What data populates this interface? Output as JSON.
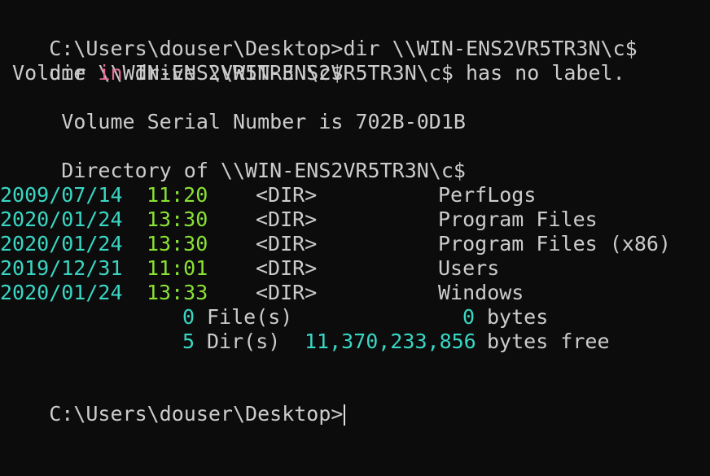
{
  "terminal": {
    "prompt_command": "C:\\Users\\douser\\Desktop>dir \\\\WIN-ENS2VR5TR3N\\c$",
    "echo": "dir \\\\WIN-ENS2VR5TR3N\\c$",
    "volume_pre": " Volume ",
    "volume_kw": "in",
    "volume_post": " drive \\\\WIN-ENS2VR5TR3N\\c$ has no label.",
    "serial": " Volume Serial Number is 702B-0D1B",
    "directory_of": " Directory of \\\\WIN-ENS2VR5TR3N\\c$",
    "entries": [
      {
        "date": "2009/07/14",
        "time": "11:20",
        "type": "<DIR>",
        "name": "PerfLogs"
      },
      {
        "date": "2020/01/24",
        "time": "13:30",
        "type": "<DIR>",
        "name": "Program Files"
      },
      {
        "date": "2020/01/24",
        "time": "13:30",
        "type": "<DIR>",
        "name": "Program Files (x86)"
      },
      {
        "date": "2019/12/31",
        "time": "11:01",
        "type": "<DIR>",
        "name": "Users"
      },
      {
        "date": "2020/01/24",
        "time": "13:33",
        "type": "<DIR>",
        "name": "Windows"
      }
    ],
    "summary": {
      "files_count": "0",
      "files_label": "File(s)",
      "files_bytes": "0",
      "bytes_label": "bytes",
      "dirs_count": "5",
      "dirs_label": "Dir(s)",
      "free_bytes": "11,370,233,856",
      "free_label": "bytes free"
    },
    "final_prompt": "C:\\Users\\douser\\Desktop>"
  },
  "colors": {
    "background": "#0c0c0c",
    "text": "#cccccc",
    "date": "#3ad6c4",
    "time": "#8ae234",
    "keyword": "#e06c95"
  }
}
